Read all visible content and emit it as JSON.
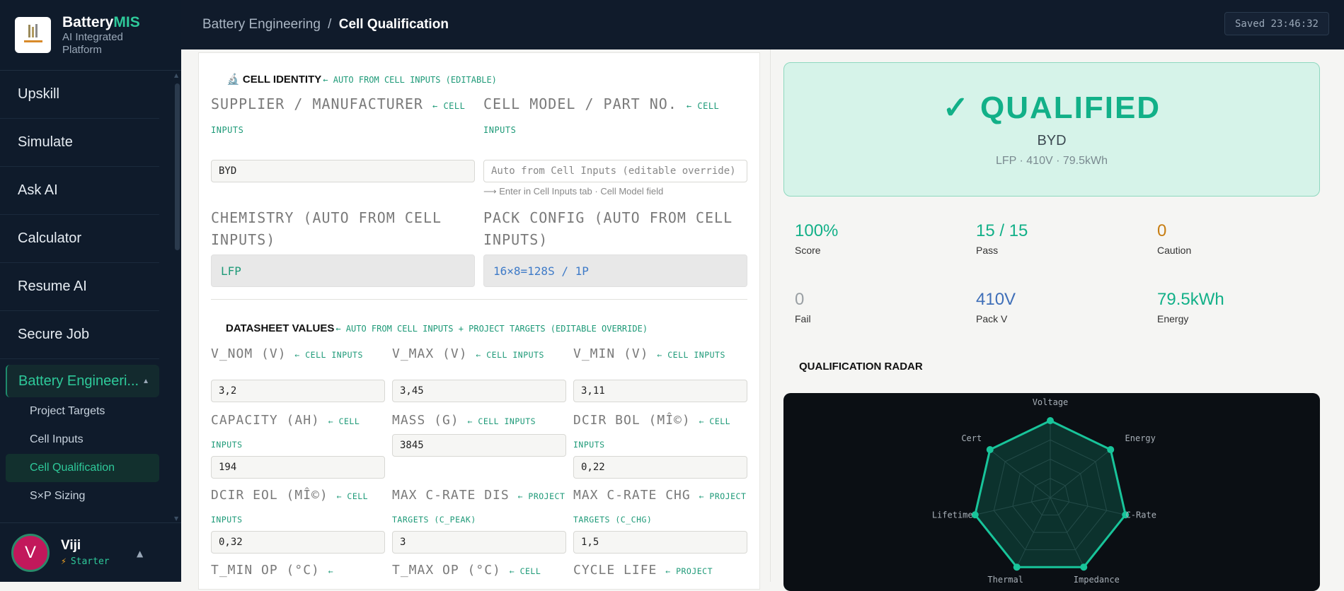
{
  "brand": {
    "name_main": "Battery",
    "name_accent": "MIS",
    "subtitle": "AI Integrated Platform",
    "logo_text": "BatteryMIS"
  },
  "nav": {
    "items": [
      {
        "label": "Upskill"
      },
      {
        "label": "Simulate"
      },
      {
        "label": "Ask AI"
      },
      {
        "label": "Calculator"
      },
      {
        "label": "Resume AI"
      },
      {
        "label": "Secure Job"
      }
    ],
    "group": {
      "label": "Battery Engineeri...",
      "caret": "▲"
    },
    "subitems": [
      {
        "label": "Project Targets"
      },
      {
        "label": "Cell Inputs"
      },
      {
        "label": "Cell Qualification"
      },
      {
        "label": "S×P Sizing"
      }
    ]
  },
  "user": {
    "initial": "V",
    "name": "Viji",
    "plan": "Starter"
  },
  "topbar": {
    "crumb_parent": "Battery Engineering",
    "crumb_sep": "/",
    "crumb_current": "Cell Qualification",
    "saved": "Saved 23:46:32"
  },
  "identity": {
    "title": "CELL IDENTITY",
    "title_hint": "← AUTO FROM CELL INPUTS (EDITABLE)",
    "supplier": {
      "label": "SUPPLIER / MANUFACTURER",
      "hint": "← CELL INPUTS",
      "value": "BYD"
    },
    "model": {
      "label": "CELL MODEL / PART NO.",
      "hint": "← CELL INPUTS",
      "placeholder": "Auto from Cell Inputs (editable override)",
      "helper": "⟶ Enter in Cell Inputs tab · Cell Model field"
    },
    "chemistry": {
      "label": "CHEMISTRY (AUTO FROM CELL INPUTS)",
      "value": "LFP"
    },
    "pack": {
      "label": "PACK CONFIG (AUTO FROM CELL INPUTS)",
      "value": "16×8=128S / 1P"
    }
  },
  "datasheet": {
    "title": "DATASHEET VALUES",
    "title_hint": "← AUTO FROM CELL INPUTS + PROJECT TARGETS (EDITABLE OVERRIDE)",
    "fields": [
      {
        "label": "V_NOM (V)",
        "hint": "← CELL INPUTS",
        "value": "3,2"
      },
      {
        "label": "V_MAX (V)",
        "hint": "← CELL INPUTS",
        "value": "3,45"
      },
      {
        "label": "V_MIN (V)",
        "hint": "← CELL INPUTS",
        "value": "3,11"
      },
      {
        "label": "CAPACITY (AH)",
        "hint": "← CELL INPUTS",
        "value": "194"
      },
      {
        "label": "MASS (G)",
        "hint": "← CELL INPUTS",
        "value": "3845"
      },
      {
        "label": "DCIR BOL (MÎ©)",
        "hint": "← CELL INPUTS",
        "value": "0,22"
      },
      {
        "label": "DCIR EOL (MÎ©)",
        "hint": "← CELL INPUTS",
        "value": "0,32"
      },
      {
        "label": "MAX C-RATE DIS",
        "hint": "← PROJECT TARGETS (C_PEAK)",
        "value": "3"
      },
      {
        "label": "MAX C-RATE CHG",
        "hint": "← PROJECT TARGETS (C_CHG)",
        "value": "1,5"
      },
      {
        "label": "T_MIN OP (°C)",
        "hint": "←"
      },
      {
        "label": "T_MAX OP (°C)",
        "hint": "← CELL"
      },
      {
        "label": "CYCLE LIFE",
        "hint": "← PROJECT"
      }
    ]
  },
  "verdict": {
    "title": "✓ QUALIFIED",
    "supplier": "BYD",
    "meta": "LFP · 410V · 79.5kWh",
    "accent": "#12b088"
  },
  "stats": [
    {
      "value": "100%",
      "label": "Score",
      "color": "#12b088"
    },
    {
      "value": "15 / 15",
      "label": "Pass",
      "color": "#12b088"
    },
    {
      "value": "0",
      "label": "Caution",
      "color": "#c77d12"
    },
    {
      "value": "0",
      "label": "Fail",
      "color": "#9aa0a4"
    },
    {
      "value": "410V",
      "label": "Pack V",
      "color": "#3f6fb8"
    },
    {
      "value": "79.5kWh",
      "label": "Energy",
      "color": "#12b088"
    }
  ],
  "radar": {
    "title": "QUALIFICATION RADAR",
    "axes": [
      "Voltage",
      "Energy",
      "C-Rate",
      "Impedance",
      "Thermal",
      "Lifetime",
      "Cert"
    ],
    "values": [
      1,
      1,
      1,
      1,
      1,
      1,
      1
    ]
  }
}
